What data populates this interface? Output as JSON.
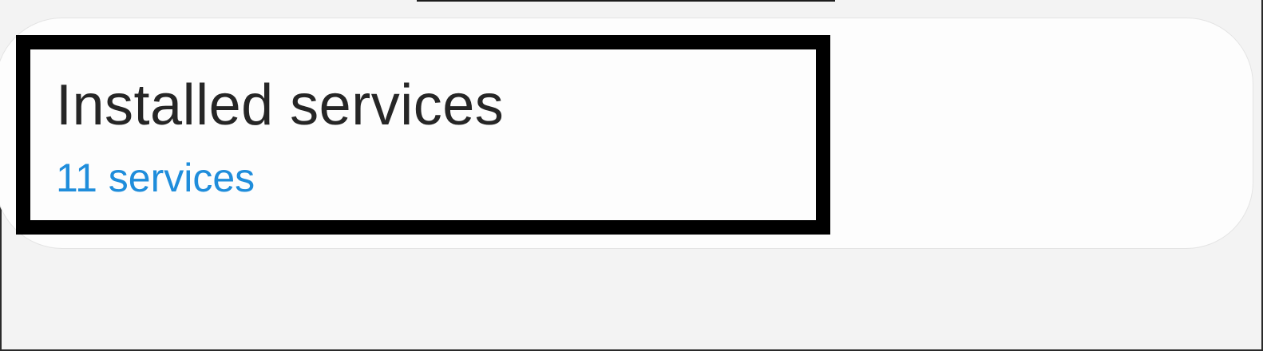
{
  "installed_services": {
    "title": "Installed services",
    "count_label": "11 services"
  },
  "colors": {
    "background": "#f3f3f3",
    "card": "#fdfdfd",
    "title_text": "#262626",
    "accent": "#1f8ddb",
    "highlight_border": "#000000"
  }
}
